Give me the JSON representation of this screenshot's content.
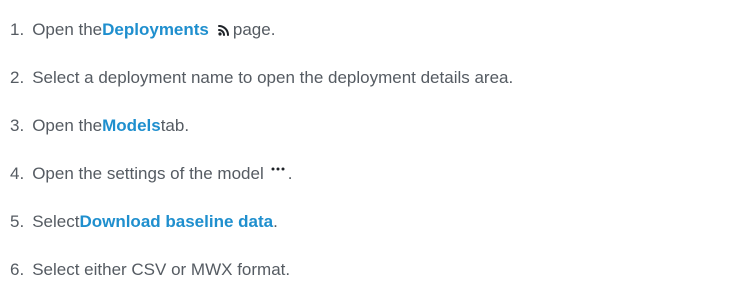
{
  "steps": [
    {
      "number": "1.",
      "text_before": "Open the ",
      "bold": "Deployments",
      "icon": "deployments-icon",
      "text_after": " page."
    },
    {
      "number": "2.",
      "text": "Select a deployment name to open the deployment details area."
    },
    {
      "number": "3.",
      "text_before": "Open the ",
      "bold": "Models",
      "text_after": " tab."
    },
    {
      "number": "4.",
      "text_before": "Open the settings of the model",
      "icon": "more-options-icon",
      "text_after": "."
    },
    {
      "number": "5.",
      "text_before": "Select ",
      "bold": "Download baseline data",
      "text_after": "."
    },
    {
      "number": "6.",
      "text": "Select either CSV or MWX format."
    }
  ],
  "colors": {
    "text": "#555b62",
    "link": "#1f8fce",
    "icon": "#1f2328"
  }
}
